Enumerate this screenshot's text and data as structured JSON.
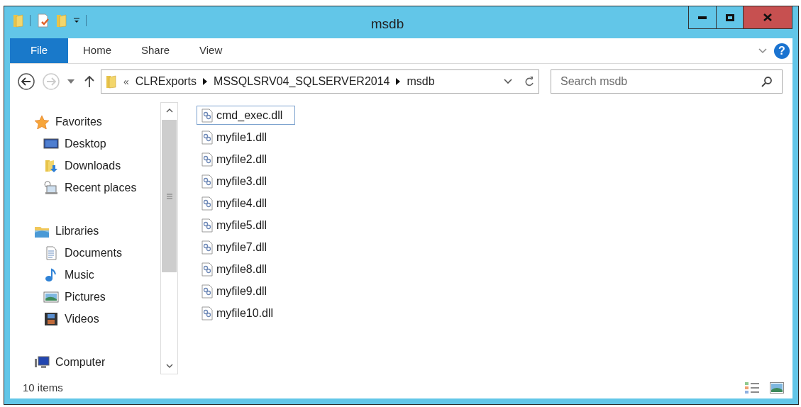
{
  "window": {
    "title": "msdb"
  },
  "ribbon": {
    "tabs": [
      {
        "label": "File",
        "kind": "file"
      },
      {
        "label": "Home",
        "kind": "tab"
      },
      {
        "label": "Share",
        "kind": "tab"
      },
      {
        "label": "View",
        "kind": "tab"
      }
    ],
    "help": "?"
  },
  "address": {
    "overflow": "«",
    "segments": [
      "CLRExports",
      "MSSQLSRV04_SQLSERVER2014",
      "msdb"
    ]
  },
  "search": {
    "placeholder": "Search msdb"
  },
  "navigation": [
    {
      "label": "Favorites",
      "kind": "star",
      "children": [
        {
          "label": "Desktop",
          "kind": "desktop"
        },
        {
          "label": "Downloads",
          "kind": "downloads"
        },
        {
          "label": "Recent places",
          "kind": "recent"
        }
      ]
    },
    {
      "label": "Libraries",
      "kind": "library",
      "children": [
        {
          "label": "Documents",
          "kind": "document"
        },
        {
          "label": "Music",
          "kind": "music"
        },
        {
          "label": "Pictures",
          "kind": "pictures"
        },
        {
          "label": "Videos",
          "kind": "videos"
        }
      ]
    },
    {
      "label": "Computer",
      "kind": "computer"
    }
  ],
  "files": [
    {
      "name": "cmd_exec.dll",
      "selected": true
    },
    {
      "name": "myfile1.dll",
      "selected": false
    },
    {
      "name": "myfile2.dll",
      "selected": false
    },
    {
      "name": "myfile3.dll",
      "selected": false
    },
    {
      "name": "myfile4.dll",
      "selected": false
    },
    {
      "name": "myfile5.dll",
      "selected": false
    },
    {
      "name": "myfile7.dll",
      "selected": false
    },
    {
      "name": "myfile8.dll",
      "selected": false
    },
    {
      "name": "myfile9.dll",
      "selected": false
    },
    {
      "name": "myfile10.dll",
      "selected": false
    }
  ],
  "status_bar": {
    "count": "10 items"
  }
}
